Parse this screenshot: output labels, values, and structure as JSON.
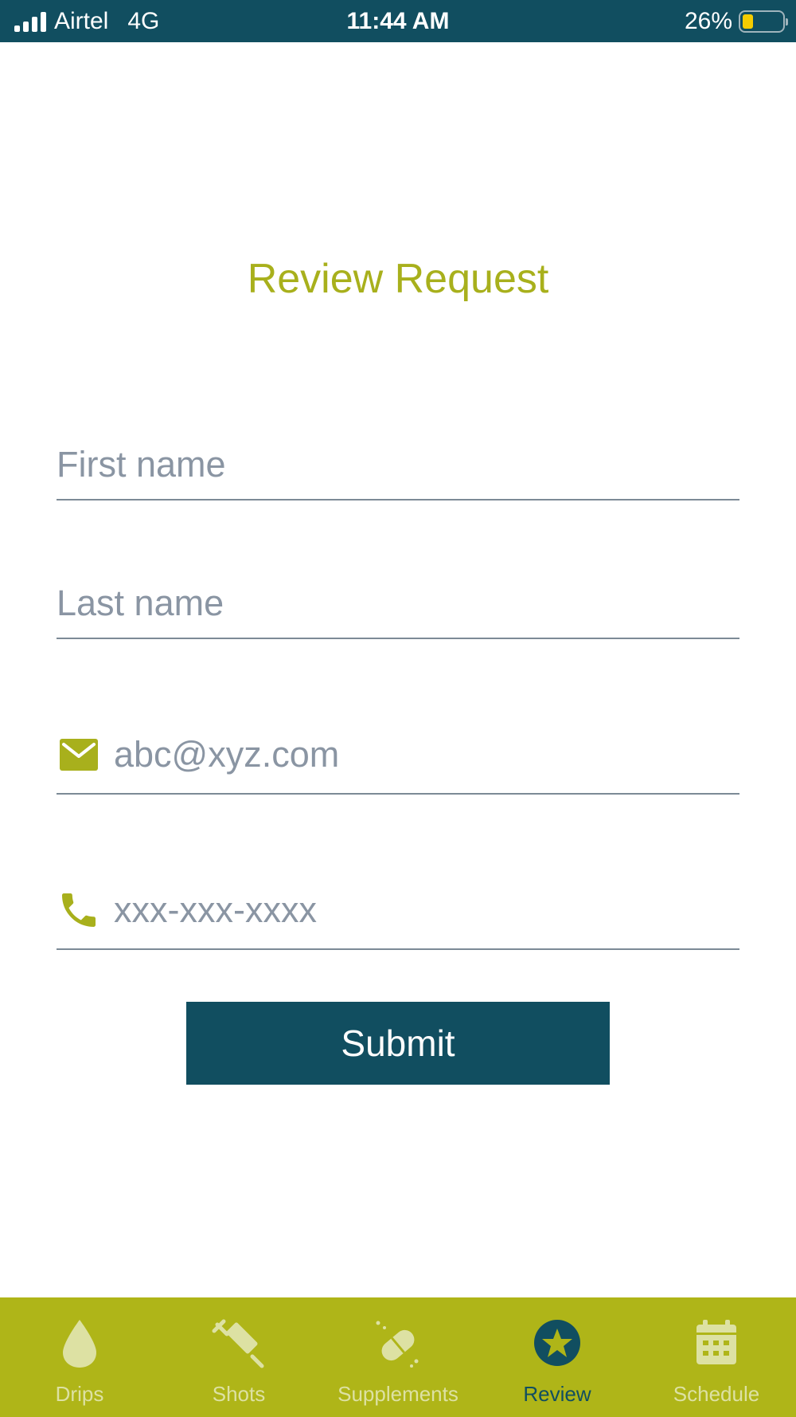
{
  "status_bar": {
    "carrier": "Airtel",
    "network": "4G",
    "time": "11:44 AM",
    "battery_percent": "26%",
    "battery_level": 0.26
  },
  "page": {
    "title": "Review Request"
  },
  "form": {
    "first_name_placeholder": "First name",
    "last_name_placeholder": "Last name",
    "email_placeholder": "abc@xyz.com",
    "phone_placeholder": "xxx-xxx-xxxx",
    "submit_label": "Submit"
  },
  "tabs": [
    {
      "label": "Drips",
      "icon": "drop-icon",
      "active": false
    },
    {
      "label": "Shots",
      "icon": "syringe-icon",
      "active": false
    },
    {
      "label": "Supplements",
      "icon": "pill-icon",
      "active": false
    },
    {
      "label": "Review",
      "icon": "star-icon",
      "active": true
    },
    {
      "label": "Schedule",
      "icon": "calendar-icon",
      "active": false
    }
  ],
  "colors": {
    "primary": "#114e60",
    "accent": "#afb518",
    "title": "#a8b01c",
    "inactive_tab": "#dde1a3"
  }
}
